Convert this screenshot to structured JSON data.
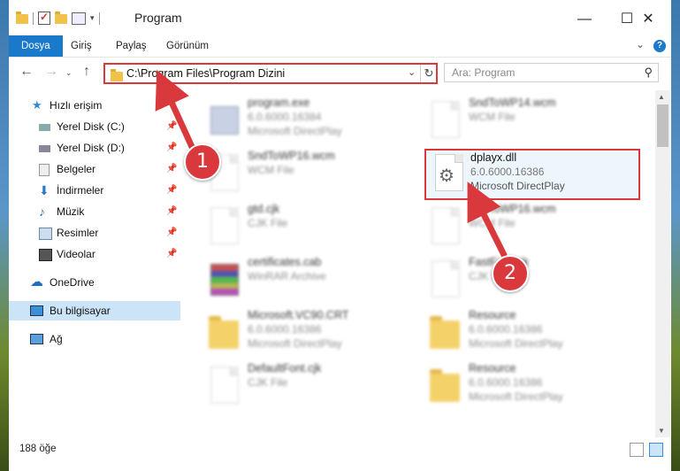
{
  "window": {
    "title": "Program",
    "controls": {
      "minimize": "—",
      "maximize": "☐",
      "close": "✕"
    }
  },
  "ribbon": {
    "tabs": [
      "Dosya",
      "Giriş",
      "Paylaş",
      "Görünüm"
    ],
    "help": "?"
  },
  "address": {
    "path": "C:\\Program Files\\Program Dizini",
    "search_placeholder": "Ara: Program"
  },
  "sidebar": {
    "items": [
      {
        "label": "Hızlı erişim",
        "icon": "star-icon",
        "pinned": false
      },
      {
        "label": "Yerel Disk (C:)",
        "icon": "drive-icon",
        "pinned": true
      },
      {
        "label": "Yerel Disk (D:)",
        "icon": "drive-icon",
        "pinned": true
      },
      {
        "label": "Belgeler",
        "icon": "documents-icon",
        "pinned": true
      },
      {
        "label": "İndirmeler",
        "icon": "download-icon",
        "pinned": true
      },
      {
        "label": "Müzik",
        "icon": "music-icon",
        "pinned": true
      },
      {
        "label": "Resimler",
        "icon": "pictures-icon",
        "pinned": true
      },
      {
        "label": "Videolar",
        "icon": "videos-icon",
        "pinned": true
      },
      {
        "label": "OneDrive",
        "icon": "cloud-icon",
        "pinned": false
      },
      {
        "label": "Bu bilgisayar",
        "icon": "computer-icon",
        "pinned": false,
        "selected": true
      },
      {
        "label": "Ağ",
        "icon": "network-icon",
        "pinned": false
      }
    ]
  },
  "files": [
    {
      "name": "program.exe",
      "line2": "6.0.6000.16384",
      "line3": "Microsoft DirectPlay",
      "icon": "exe-icon"
    },
    {
      "name": "SndToWP14.wcm",
      "line2": "WCM File",
      "line3": "",
      "icon": "document-icon"
    },
    {
      "name": "SndToWP16.wcm",
      "line2": "WCM File",
      "line3": "",
      "icon": "document-icon"
    },
    {
      "name": "dplayx.dll",
      "line2": "6.0.6000.16386",
      "line3": "Microsoft DirectPlay",
      "icon": "dll-gear-icon"
    },
    {
      "name": "gtd.cjk",
      "line2": "CJK File",
      "line3": "",
      "icon": "document-icon"
    },
    {
      "name": "SndToWP16.wcm",
      "line2": "WCM File",
      "line3": "",
      "icon": "document-icon"
    },
    {
      "name": "certificates.cab",
      "line2": "WinRAR Archive",
      "line3": "",
      "icon": "archive-icon"
    },
    {
      "name": "FastFont.cjk",
      "line2": "CJK File",
      "line3": "",
      "icon": "document-icon"
    },
    {
      "name": "Microsoft.VC90.CRT",
      "line2": "6.0.6000.16386",
      "line3": "Microsoft DirectPlay",
      "icon": "folder-icon"
    },
    {
      "name": "Resource",
      "line2": "6.0.6000.16386",
      "line3": "Microsoft DirectPlay",
      "icon": "folder-icon"
    },
    {
      "name": "DefaultFont.cjk",
      "line2": "CJK File",
      "line3": "",
      "icon": "document-icon"
    },
    {
      "name": "Resource",
      "line2": "6.0.6000.16386",
      "line3": "Microsoft DirectPlay",
      "icon": "folder-icon"
    }
  ],
  "status": {
    "item_count": "188 öğe"
  },
  "annotations": {
    "callout_1": "1",
    "callout_2": "2",
    "color": "#d9383c"
  }
}
